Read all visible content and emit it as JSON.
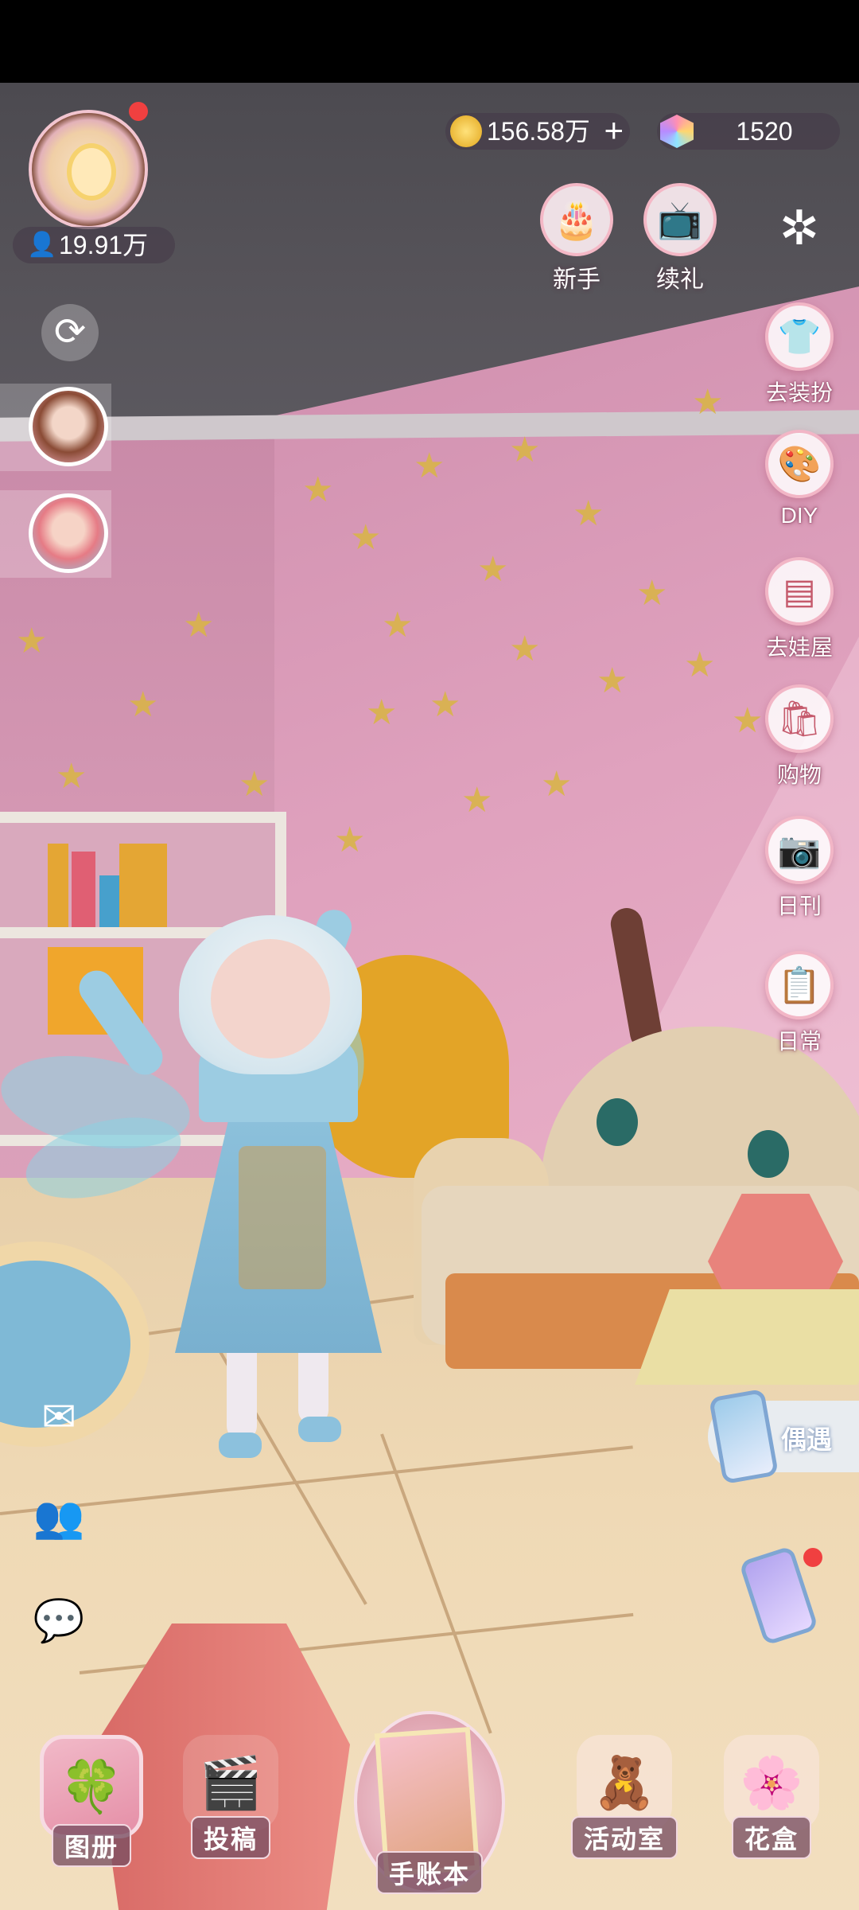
{
  "header": {
    "followers": "19.91万",
    "coins": "156.58万",
    "gems": "1520",
    "coin_plus": "+"
  },
  "top_buttons": [
    {
      "label": "新手",
      "icon": "bunny-cake-icon"
    },
    {
      "label": "续礼",
      "icon": "tv-gift-icon"
    }
  ],
  "right_menu": [
    {
      "label": "去装扮",
      "icon": "shirt-icon"
    },
    {
      "label": "DIY",
      "icon": "palette-icon"
    },
    {
      "label": "去娃屋",
      "icon": "cabinet-icon"
    },
    {
      "label": "购物",
      "icon": "shopping-bag-icon"
    },
    {
      "label": "日刊",
      "icon": "camera-icon"
    },
    {
      "label": "日常",
      "icon": "clipboard-icon"
    }
  ],
  "encounter": {
    "label": "偶遇"
  },
  "bottom_nav": [
    {
      "label": "图册",
      "icon": "album-icon"
    },
    {
      "label": "投稿",
      "icon": "film-clapper-icon"
    },
    {
      "label": "手账本",
      "icon": "journal-book-icon"
    },
    {
      "label": "活动室",
      "icon": "teddy-bear-icon"
    },
    {
      "label": "花盒",
      "icon": "flower-box-icon"
    }
  ],
  "colors": {
    "wall": "#d99bb6",
    "ceiling": "#4f4c52",
    "floor": "#efd9b5",
    "star": "#d9b44a",
    "notification": "#f04040"
  }
}
